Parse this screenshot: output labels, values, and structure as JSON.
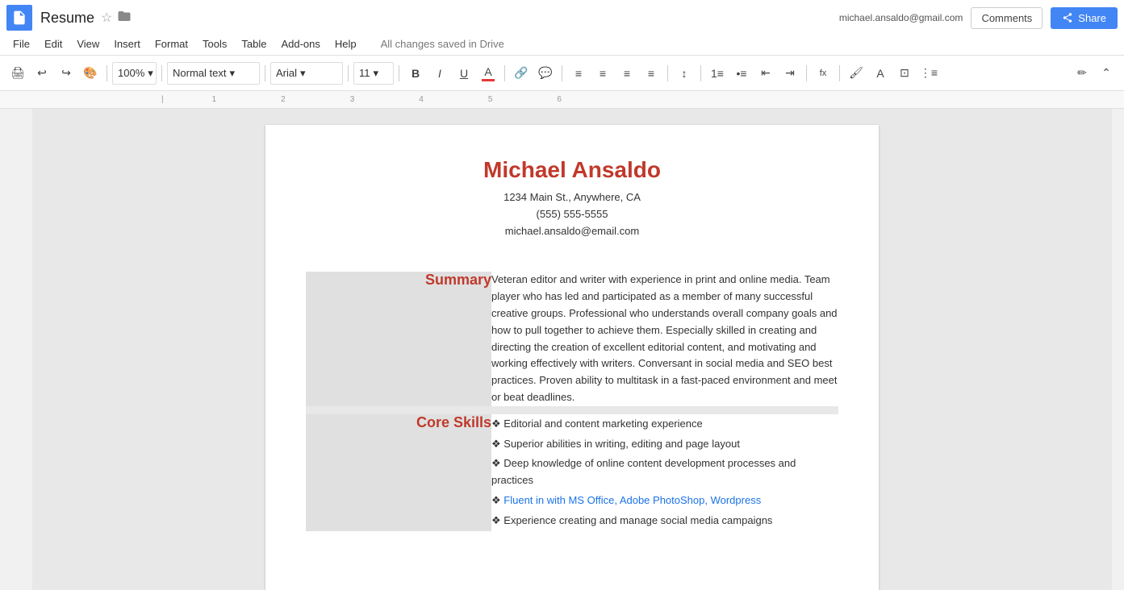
{
  "titleBar": {
    "appName": "Resume",
    "starLabel": "☆",
    "folderLabel": "📁",
    "userEmail": "michael.ansaldo@gmail.com",
    "commentsLabel": "Comments",
    "shareLabel": "Share"
  },
  "menuBar": {
    "items": [
      "File",
      "Edit",
      "View",
      "Insert",
      "Format",
      "Tools",
      "Table",
      "Add-ons",
      "Help"
    ],
    "savedStatus": "All changes saved in Drive"
  },
  "toolbar": {
    "zoom": "100%",
    "style": "Normal text",
    "font": "Arial",
    "size": "11"
  },
  "document": {
    "name": "Michael Ansaldo",
    "address": "1234 Main St., Anywhere, CA",
    "phone": "(555) 555-5555",
    "email": "michael.ansaldo@email.com",
    "sections": [
      {
        "label": "Summary",
        "content": "Veteran editor and writer with experience in print and online media. Team player who has led and participated as a member of many successful creative groups. Professional who understands overall company goals and how to pull together to achieve them. Especially skilled in creating and directing the creation of excellent editorial content, and motivating and working effectively with writers. Conversant in social media and SEO best practices. Proven ability to multitask in a fast-paced environment and meet or beat deadlines."
      },
      {
        "label": "Core Skills",
        "skills": [
          "Editorial and content marketing experience",
          "Superior abilities in writing, editing and page layout",
          "Deep knowledge of online content development processes and practices",
          "Fluent in with MS Office, Adobe PhotoShop, Wordpress",
          "Experience creating and manage social media campaigns"
        ]
      }
    ]
  }
}
